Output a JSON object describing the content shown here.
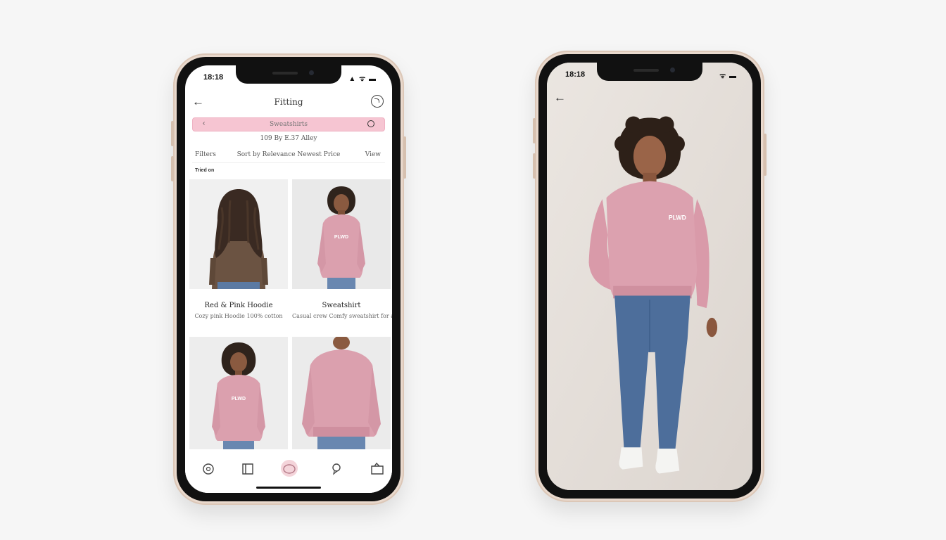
{
  "left_phone": {
    "status_time": "18:18",
    "status_icons": "▲ ᯤ ▬",
    "title": "Fitting",
    "search": {
      "placeholder": "Sweatshirts"
    },
    "subline": "109 By E.37 Alley",
    "filter": {
      "left": "Filters",
      "center": "Sort by Relevance Newest Price",
      "right": "View"
    },
    "section_label": "Tried on",
    "products": [
      {
        "name": "Red & Pink Hoodie",
        "sub": "Cozy pink Hoodie 100% cotton"
      },
      {
        "name": "Sweatshirt",
        "sub": "Casual crew Comfy sweatshirt for all"
      }
    ],
    "tabs": [
      {
        "icon": "home-icon"
      },
      {
        "icon": "catalog-icon"
      },
      {
        "icon": "fitting-room-icon"
      },
      {
        "icon": "messages-icon"
      },
      {
        "icon": "bag-icon"
      }
    ]
  },
  "right_phone": {
    "status_time": "18:18",
    "status_icons": "ᯤ ▬"
  },
  "colors": {
    "accent_pink": "#f6c5d2",
    "sweatshirt_pink": "#dba0ae",
    "denim": "#4d6e9b"
  }
}
